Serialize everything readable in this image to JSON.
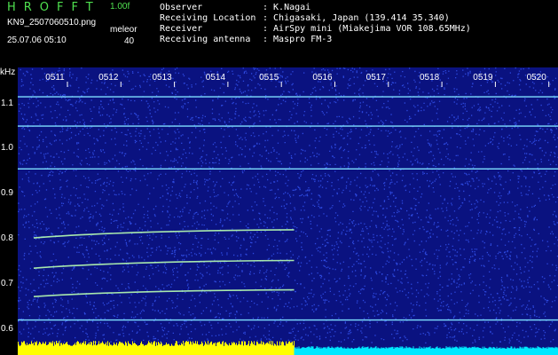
{
  "header": {
    "app_title": "HROFFT",
    "version": "1.00f",
    "file_name": "KN9_2507060510.png",
    "datetime": "25.07.06 05:10",
    "mode_label": "meleor",
    "mode_value": "40",
    "observer_label": "Observer",
    "observer_value": ": K.Nagai",
    "location_label": "Receiving Location",
    "location_value": ": Chigasaki, Japan (139.414 35.340)",
    "receiver_label": "Receiver",
    "receiver_value": ": AirSpy mini (Miakejima VOR 108.65MHz)",
    "antenna_label": "Receiving antenna",
    "antenna_value": ": Maspro FM-3"
  },
  "axis": {
    "unit": "kHz",
    "y_ticks": [
      "1.1",
      "1.0",
      "0.9",
      "0.8",
      "0.7",
      "0.6"
    ],
    "x_ticks": [
      "0511",
      "0512",
      "0513",
      "0514",
      "0515",
      "0516",
      "0517",
      "0518",
      "0519",
      "0520"
    ]
  },
  "colors": {
    "background": "#0a1280",
    "noise": "#3a5cff",
    "signal": "#7fe0ff",
    "meteor": "#b8ffb0",
    "bar_yellow": "#ffff00",
    "bar_cyan": "#00e8ff"
  },
  "chart_data": {
    "type": "heatmap",
    "y_unit": "kHz",
    "ylim": [
      0.57,
      1.18
    ],
    "x_ticks": [
      "0511",
      "0512",
      "0513",
      "0514",
      "0515",
      "0516",
      "0517",
      "0518",
      "0519",
      "0520"
    ],
    "constant_lines_khz": [
      1.115,
      1.05,
      0.955,
      0.62
    ],
    "meteor_traces": [
      {
        "start_khz": 0.802,
        "end_khz": 0.82,
        "x_start": "0511",
        "x_end": "0516"
      },
      {
        "start_khz": 0.735,
        "end_khz": 0.752,
        "x_start": "0511",
        "x_end": "0516"
      },
      {
        "start_khz": 0.672,
        "end_khz": 0.687,
        "x_start": "0511",
        "x_end": "0516"
      }
    ]
  }
}
